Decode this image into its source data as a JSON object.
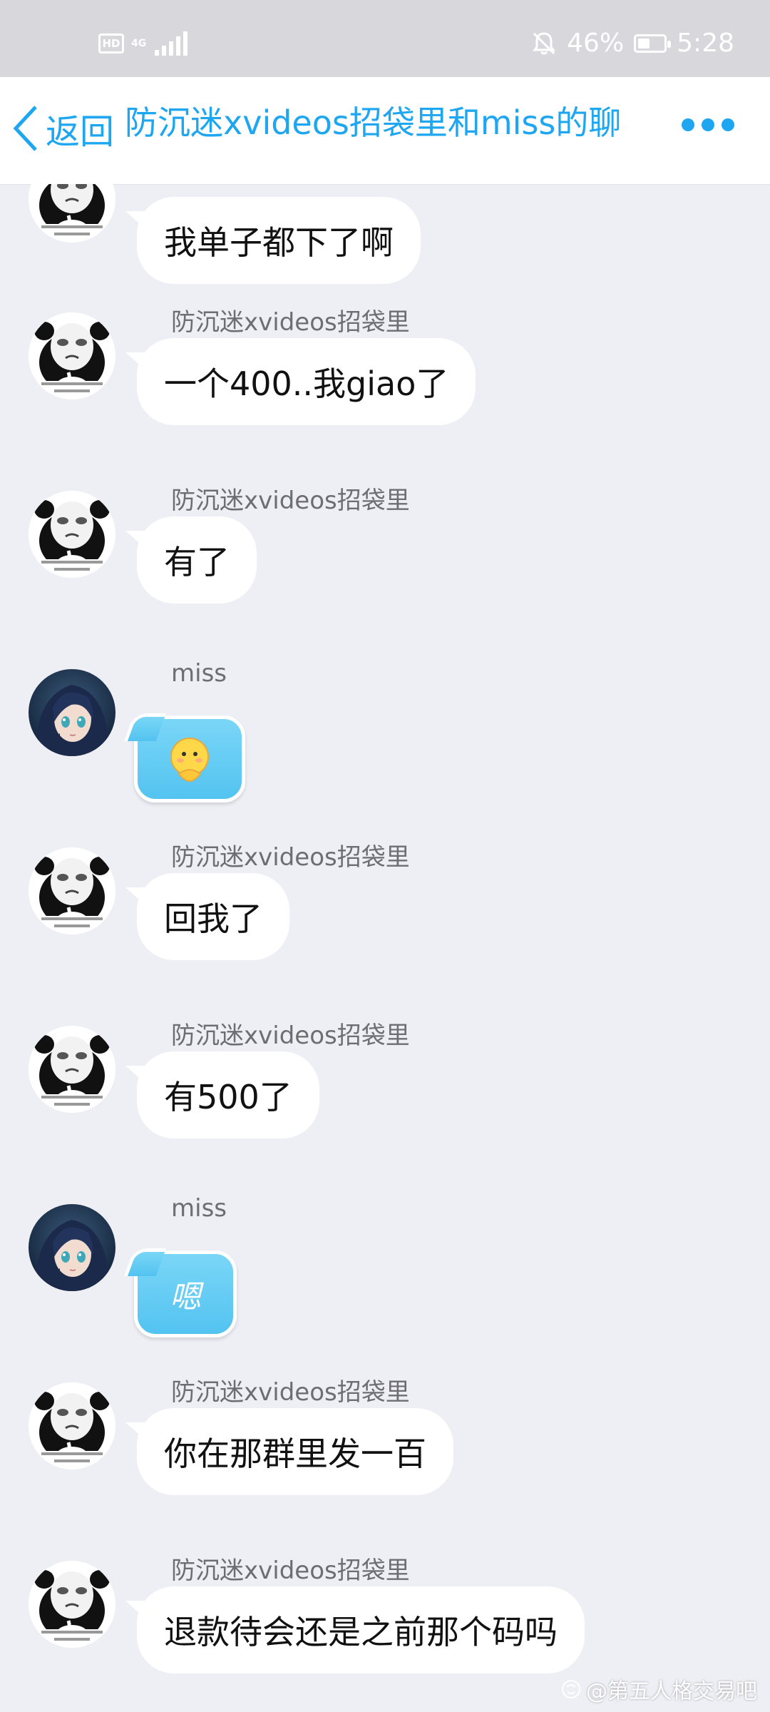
{
  "status_bar": {
    "hd": "HD",
    "network": "4G",
    "battery": "46%",
    "battery_level": 0.46,
    "time": "5:28",
    "icons": [
      "hd-icon",
      "signal-icon",
      "mute-bell-icon",
      "battery-icon"
    ]
  },
  "header": {
    "back_label": "返回",
    "title": "防沉迷xvideos招袋里和miss的聊",
    "colors": {
      "accent": "#1ea7f0"
    }
  },
  "messages": [
    {
      "sender": "",
      "avatar": "panda",
      "type": "text",
      "text": "我单子都下了啊"
    },
    {
      "sender": "防沉迷xvideos招袋里",
      "avatar": "panda",
      "type": "text",
      "text": "一个400..我giao了"
    },
    {
      "sender": "防沉迷xvideos招袋里",
      "avatar": "panda",
      "type": "text",
      "text": "有了"
    },
    {
      "sender": "miss",
      "avatar": "anime",
      "type": "sticker",
      "sticker": "thinking-face"
    },
    {
      "sender": "防沉迷xvideos招袋里",
      "avatar": "panda",
      "type": "text",
      "text": "回我了"
    },
    {
      "sender": "防沉迷xvideos招袋里",
      "avatar": "panda",
      "type": "text",
      "text": "有500了"
    },
    {
      "sender": "miss",
      "avatar": "anime",
      "type": "sticker",
      "text": "嗯"
    },
    {
      "sender": "防沉迷xvideos招袋里",
      "avatar": "panda",
      "type": "text",
      "text": "你在那群里发一百"
    },
    {
      "sender": "防沉迷xvideos招袋里",
      "avatar": "panda",
      "type": "text",
      "text": "退款待会还是之前那个码吗"
    }
  ],
  "watermark": "@第五人格交易吧"
}
